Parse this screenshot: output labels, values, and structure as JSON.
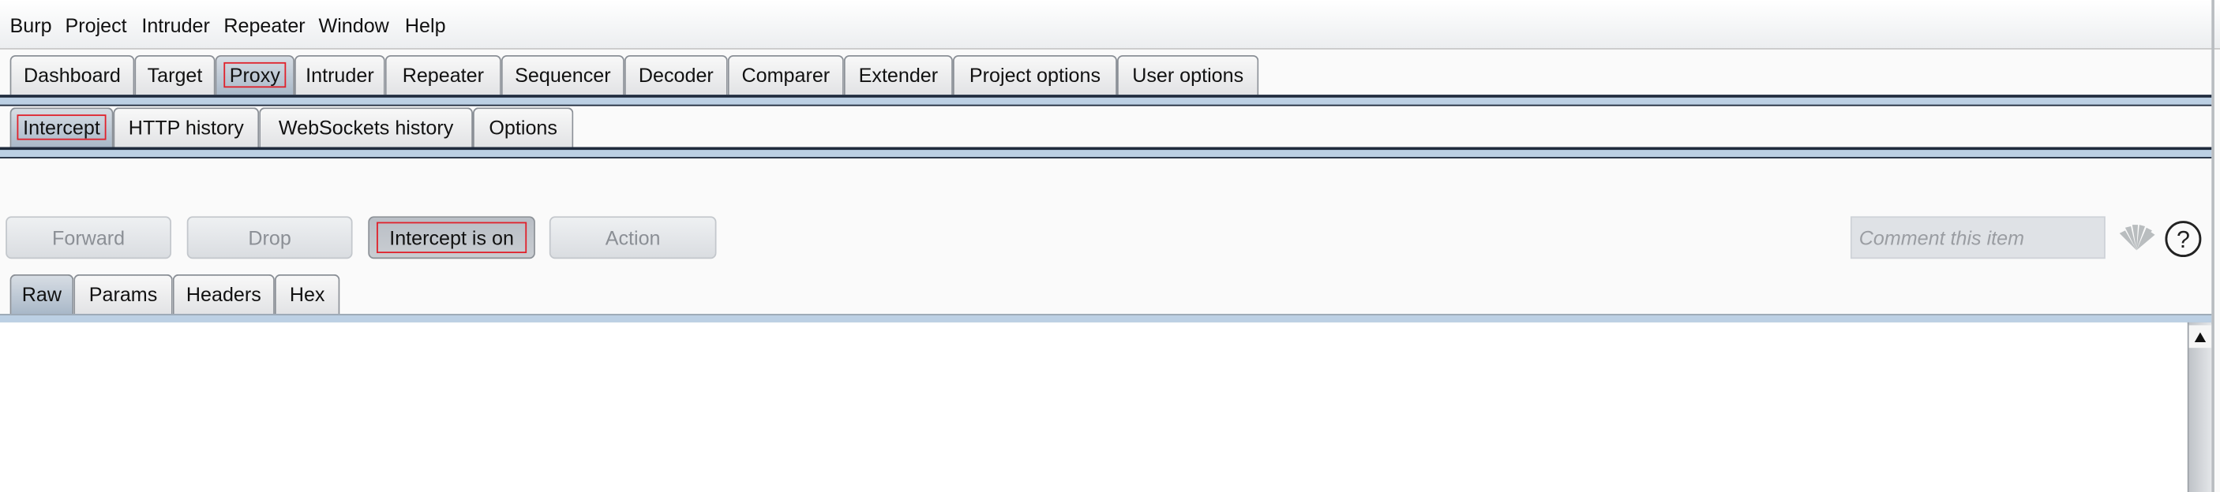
{
  "menu": [
    "Burp",
    "Project",
    "Intruder",
    "Repeater",
    "Window",
    "Help"
  ],
  "main_tabs": [
    "Dashboard",
    "Target",
    "Proxy",
    "Intruder",
    "Repeater",
    "Sequencer",
    "Decoder",
    "Comparer",
    "Extender",
    "Project options",
    "User options"
  ],
  "main_tabs_selected": "Proxy",
  "proxy_tabs": [
    "Intercept",
    "HTTP history",
    "WebSockets history",
    "Options"
  ],
  "proxy_tabs_selected": "Intercept",
  "toolbar": {
    "forward": "Forward",
    "drop": "Drop",
    "intercept": "Intercept is on",
    "action": "Action",
    "comment_placeholder": "Comment this item"
  },
  "message_tabs": [
    "Raw",
    "Params",
    "Headers",
    "Hex"
  ],
  "message_tabs_selected": "Raw",
  "highlight_color": "#e0202a"
}
